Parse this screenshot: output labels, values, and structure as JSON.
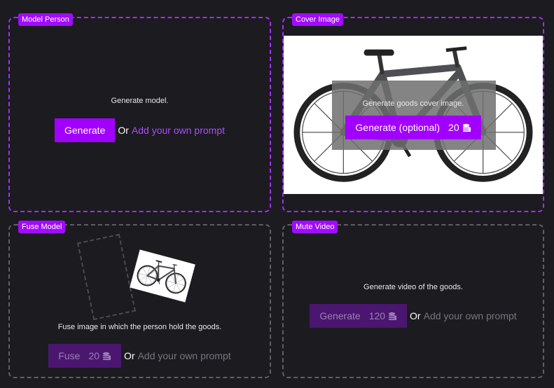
{
  "panels": {
    "model_person": {
      "tag": "Model Person",
      "description": "Generate model.",
      "button_label": "Generate",
      "or_label": "Or",
      "prompt_link": "Add your own prompt"
    },
    "cover_image": {
      "tag": "Cover Image",
      "description": "Generate goods cover image.",
      "button_label": "Generate (optional)",
      "cost": "20"
    },
    "fuse_model": {
      "tag": "Fuse Model",
      "description": "Fuse image in which the person hold the goods.",
      "button_label": "Fuse",
      "cost": "20",
      "or_label": "Or",
      "prompt_link": "Add your own prompt"
    },
    "mute_video": {
      "tag": "Mute Video",
      "description": "Generate video of the goods.",
      "button_label": "Generate",
      "cost": "120",
      "or_label": "Or",
      "prompt_link": "Add your own prompt"
    }
  },
  "icons": {
    "coin": "coin-stack-icon",
    "bike": "bicycle-image"
  },
  "colors": {
    "accent": "#a100ff",
    "background": "#1c1b20",
    "muted_button": "#4a1670",
    "inactive_border": "#5f5f66"
  }
}
